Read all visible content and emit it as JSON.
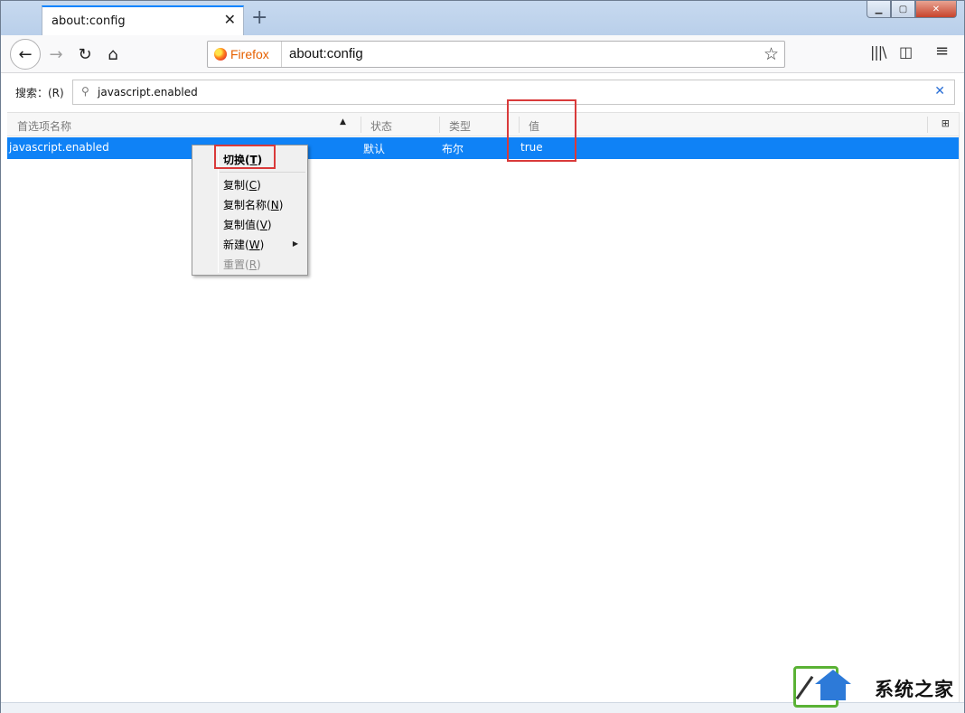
{
  "tab": {
    "title": "about:config",
    "close": "✕",
    "new_tab": "+"
  },
  "window_controls": {
    "minimize": "▁",
    "maximize": "▢",
    "close": "✕"
  },
  "navbar": {
    "back": "←",
    "forward": "→",
    "reload": "↻",
    "home": "⌂",
    "identity_label": "Firefox",
    "url": "about:config",
    "bookmark_star": "☆",
    "library": "|||\\",
    "sidebar": "◫",
    "menu": "≡"
  },
  "config": {
    "search_label": "搜索：(R)",
    "search_glass": "⚲",
    "search_value": "javascript.enabled",
    "search_clear": "✕",
    "columns": {
      "name": "首选项名称",
      "status": "状态",
      "type": "类型",
      "value": "值"
    },
    "sort_arrow": "▲",
    "column_picker": "⊞",
    "rows": [
      {
        "name": "javascript.enabled",
        "status": "默认",
        "type": "布尔",
        "value": "true"
      }
    ]
  },
  "context_menu": {
    "items": [
      {
        "label": "切换",
        "key": "T"
      },
      {
        "label": "复制",
        "key": "C"
      },
      {
        "label": "复制名称",
        "key": "N"
      },
      {
        "label": "复制值",
        "key": "V"
      },
      {
        "label": "新建",
        "key": "W"
      },
      {
        "label": "重置",
        "key": "R"
      }
    ],
    "submenu_arrow": "▶"
  },
  "watermark": {
    "text": "系统之家"
  },
  "colors": {
    "selection": "#0f82f6",
    "highlight_box": "#d93a3a",
    "firefox_orange": "#e66000"
  }
}
